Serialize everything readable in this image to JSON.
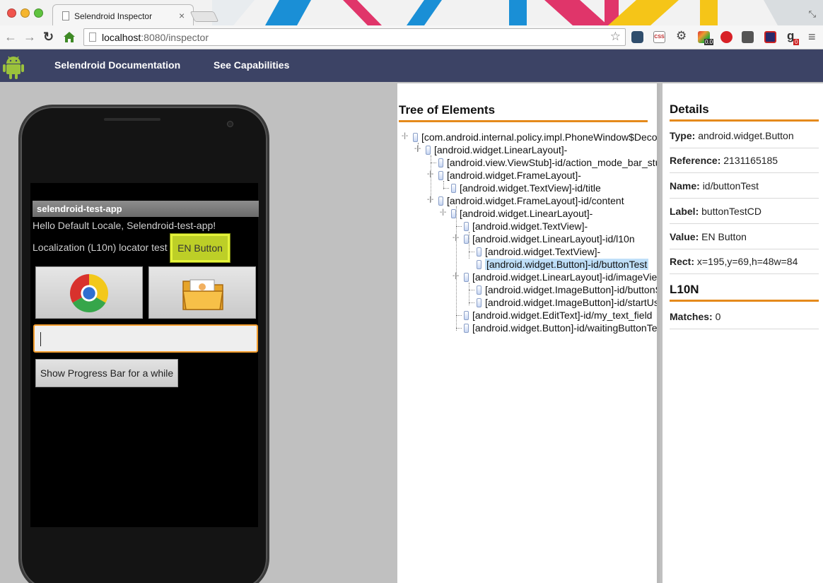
{
  "browser": {
    "tab_title": "Selendroid Inspector",
    "tab_close": "×",
    "url_host": "localhost",
    "url_path": ":8080/inspector",
    "extensions": [
      {
        "name": "camera-icon"
      },
      {
        "name": "css-viewer-icon",
        "text": "CSS"
      },
      {
        "name": "settings-gear-icon"
      },
      {
        "name": "color-picker-icon",
        "badge": "0.0"
      },
      {
        "name": "adblock-icon"
      },
      {
        "name": "screen-capture-icon"
      },
      {
        "name": "window-resizer-icon"
      },
      {
        "name": "google-icon",
        "badge": "0"
      }
    ]
  },
  "nav": {
    "documentation": "Selendroid Documentation",
    "capabilities": "See Capabilities"
  },
  "device": {
    "app_title": "selendroid-test-app",
    "hello_text": "Hello Default Locale, Selendroid-test-app!",
    "l10n_label": "Localization (L10n) locator test",
    "en_button": "EN Button",
    "progress_button": "Show Progress Bar for a while",
    "text_field_value": ""
  },
  "tree": {
    "heading": "Tree of Elements",
    "nodes": [
      {
        "label": "[com.android.internal.policy.impl.PhoneWindow$DecorView]-"
      },
      {
        "label": "[android.widget.LinearLayout]-"
      },
      {
        "label": "[android.view.ViewStub]-id/action_mode_bar_stub"
      },
      {
        "label": "[android.widget.FrameLayout]-"
      },
      {
        "label": "[android.widget.TextView]-id/title"
      },
      {
        "label": "[android.widget.FrameLayout]-id/content"
      },
      {
        "label": "[android.widget.LinearLayout]-"
      },
      {
        "label": "[android.widget.TextView]-"
      },
      {
        "label": "[android.widget.LinearLayout]-id/l10n"
      },
      {
        "label": "[android.widget.TextView]-"
      },
      {
        "label": "[android.widget.Button]-id/buttonTest"
      },
      {
        "label": "[android.widget.LinearLayout]-id/imageViewLayout"
      },
      {
        "label": "[android.widget.ImageButton]-id/buttonStartWebview"
      },
      {
        "label": "[android.widget.ImageButton]-id/startUserRegistration"
      },
      {
        "label": "[android.widget.EditText]-id/my_text_field"
      },
      {
        "label": "[android.widget.Button]-id/waitingButtonTest"
      }
    ]
  },
  "details": {
    "heading": "Details",
    "type_label": "Type:",
    "type_value": "android.widget.Button",
    "reference_label": "Reference:",
    "reference_value": "2131165185",
    "name_label": "Name:",
    "name_value": "id/buttonTest",
    "label_label": "Label:",
    "label_value": "buttonTestCD",
    "value_label": "Value:",
    "value_value": "EN Button",
    "rect_label": "Rect:",
    "rect_value": "x=195,y=69,h=48w=84",
    "l10n_heading": "L10N",
    "matches_label": "Matches:",
    "matches_value": "0"
  }
}
